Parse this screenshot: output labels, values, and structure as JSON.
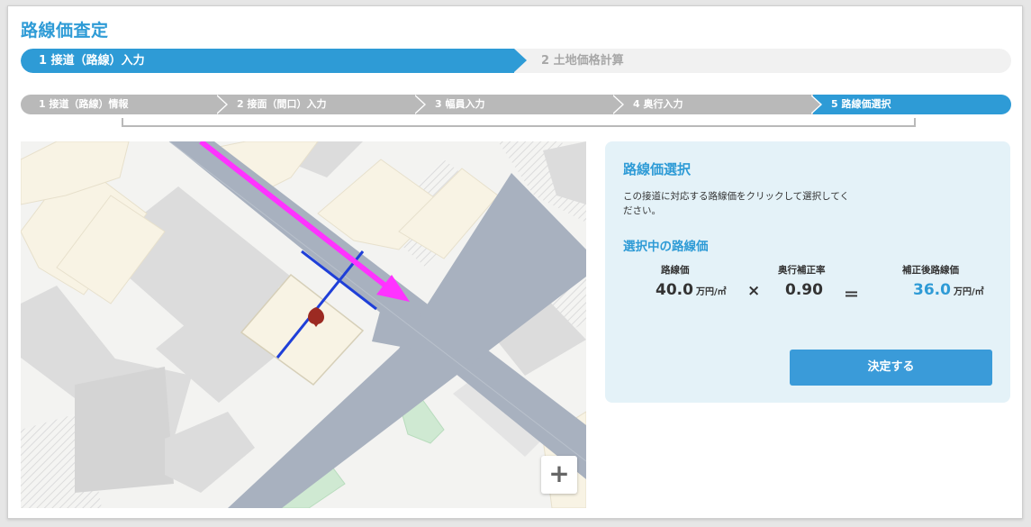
{
  "page": {
    "title": "路線価査定"
  },
  "main_steps": [
    {
      "label": "1  接道（路線）入力",
      "active": true
    },
    {
      "label": "2  土地価格計算",
      "active": false
    }
  ],
  "sub_steps": [
    {
      "label": "1  接道（路線）情報",
      "active": false
    },
    {
      "label": "2  接面（間口）入力",
      "active": false
    },
    {
      "label": "3  幅員入力",
      "active": false
    },
    {
      "label": "4  奥行入力",
      "active": false
    },
    {
      "label": "5  路線価選択",
      "active": true
    }
  ],
  "map": {
    "zoom_in_label": "+"
  },
  "panel": {
    "title": "路線価選択",
    "description": "この接道に対応する路線価をクリックして選択してください。",
    "current_title": "選択中の路線価",
    "route_price_label": "路線価",
    "route_price_value": "40.0",
    "route_price_unit": "万円/㎡",
    "multiply_sign": "×",
    "depth_rate_label": "奥行補正率",
    "depth_rate_value": "0.90",
    "equals_sign": "＝",
    "adjusted_label": "補正後路線価",
    "adjusted_value": "36.0",
    "adjusted_unit": "万円/㎡",
    "decide_button": "決定する"
  },
  "colors": {
    "accent": "#2e9bd6",
    "inactive_step": "#b9b9b9",
    "panel_bg": "#e4f2f8",
    "road": "#a8b1bf",
    "arrow": "#ff33ff",
    "marker": "#9c2a22",
    "frontage_line": "#1f3fd8"
  }
}
